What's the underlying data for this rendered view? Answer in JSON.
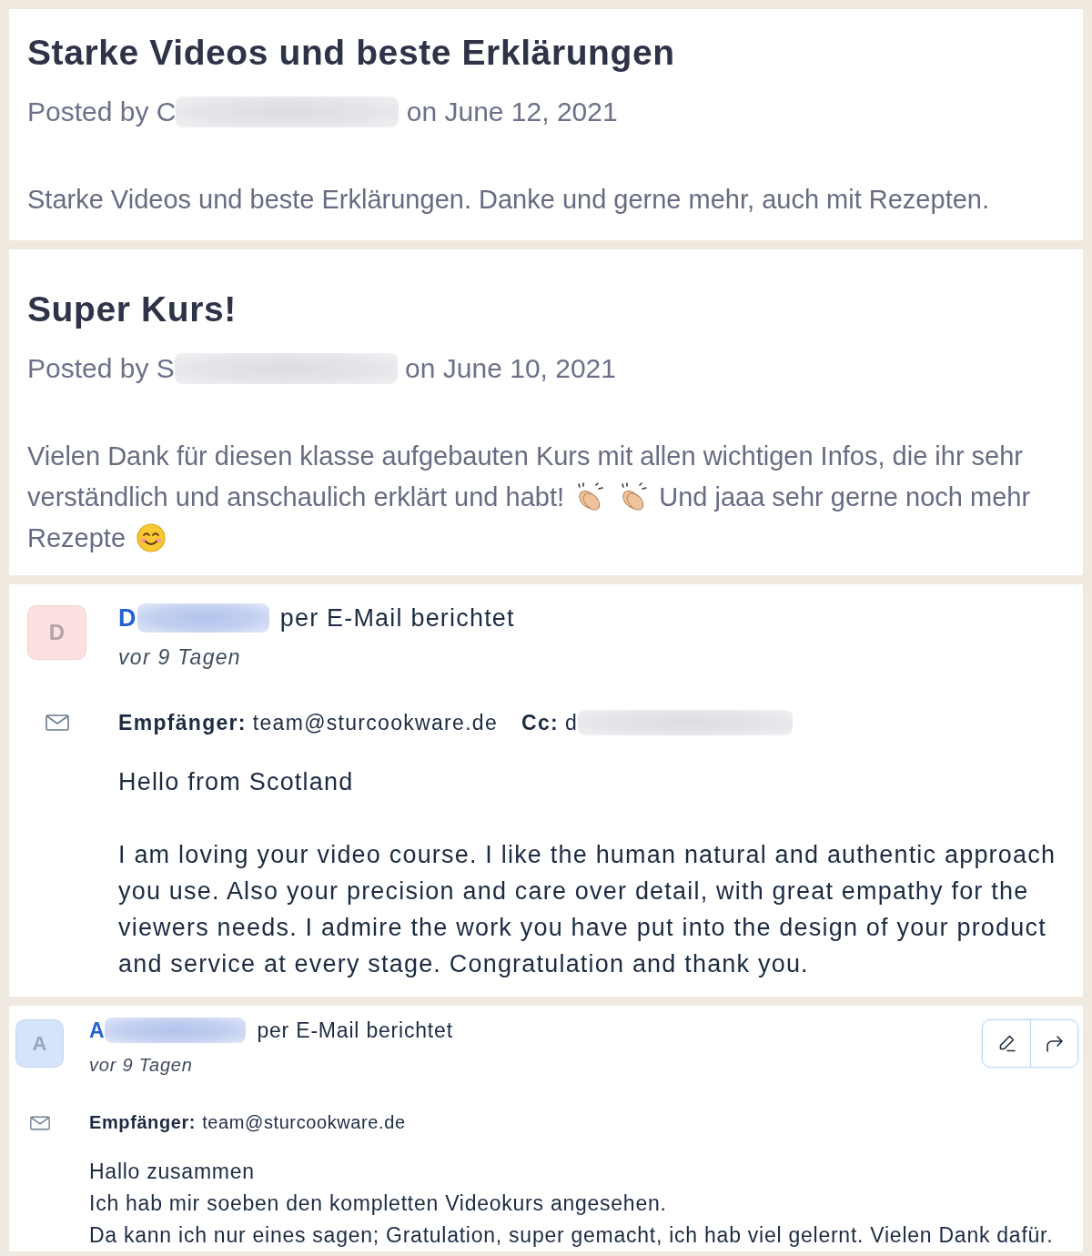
{
  "reviews": [
    {
      "title": "Starke Videos und beste Erklärungen",
      "byline": "Posted by C",
      "redacted": true,
      "date": "on June 12, 2021",
      "body": [
        {
          "kind": "text",
          "text": "Starke Videos und beste Erklärungen. Danke und gerne mehr, auch mit Rezepten."
        }
      ]
    },
    {
      "title": "Super Kurs!",
      "byline": "Posted by S",
      "redacted": true,
      "date": "on June 10, 2021",
      "body": [
        {
          "kind": "text",
          "text": "Vielen Dank für diesen klasse aufgebauten Kurs mit allen wichtigen Infos, die ihr sehr"
        },
        {
          "kind": "text",
          "text": "verständlich und anschaulich erklärt und habt!"
        },
        {
          "kind": "clap"
        },
        {
          "kind": "clap"
        },
        {
          "kind": "text",
          "text": "Und jaaa sehr gerne noch mehr"
        },
        {
          "kind": "text",
          "text": "Rezepte"
        },
        {
          "kind": "smile"
        }
      ]
    }
  ],
  "emails": [
    {
      "kind": "large",
      "avatar_letter": "D",
      "color": "#fde0e0",
      "sender": "D",
      "redacted": true,
      "action": "per E-Mail berichtet",
      "time": "vor 9 Tagen",
      "recipients": [
        {
          "label": "Empfänger:",
          "value": "team@sturcookware.de",
          "redacted": false
        },
        {
          "label": "Cc:",
          "value": "d",
          "redacted": true
        }
      ],
      "paragraphs": [
        "Hello from Scotland",
        "I am loving your video course. I like the human natural and authentic approach you use. Also your precision and care over detail, with great empathy for the viewers needs. I admire the work you have put into the design of your product and service at every stage. Congratulation and thank you."
      ]
    },
    {
      "kind": "compact",
      "avatar_letter": "A",
      "color": "#d4e4fb",
      "sender": "A",
      "redacted": true,
      "action": "per E-Mail berichtet",
      "time": "vor 9 Tagen",
      "actions": [
        {
          "kind": "edit"
        },
        {
          "kind": "forward"
        }
      ],
      "recipients": [
        {
          "label": "Empfänger:",
          "value": "team@sturcookware.de",
          "redacted": false
        }
      ],
      "paragraphs": [
        "Hallo zusammen",
        "Ich hab mir soeben den kompletten Videokurs angesehen.",
        "Da kann ich nur eines sagen; Gratulation, super gemacht, ich hab viel gelernt. Vielen Dank dafür."
      ]
    }
  ]
}
